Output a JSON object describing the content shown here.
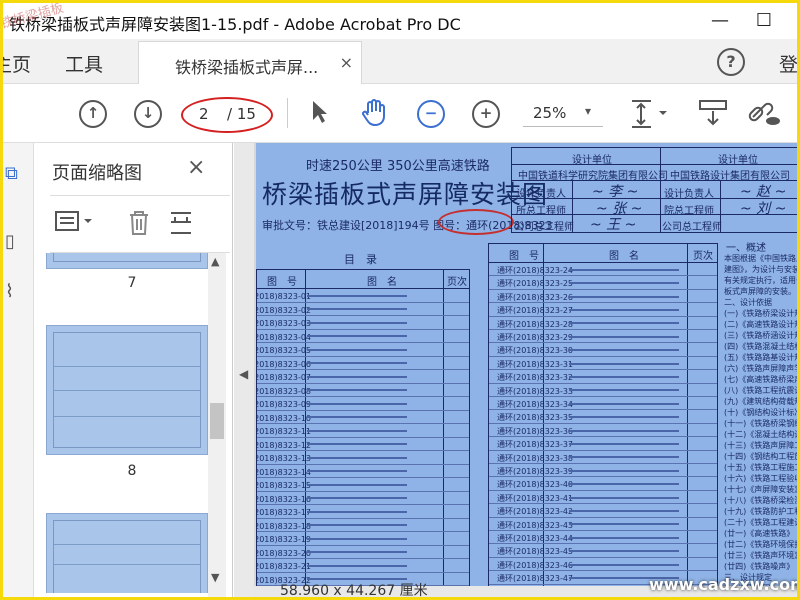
{
  "window": {
    "title": "铁桥梁插板式声屏障安装图1-15.pdf - Adobe Acrobat Pro DC",
    "minimize": "—",
    "maximize": "☐"
  },
  "menu": {
    "home": "主页",
    "tools": "工具",
    "tab_label": "铁桥梁插板式声屏...",
    "tab_close": "×",
    "help": "?",
    "login": "登"
  },
  "toolbar": {
    "page_current": "2",
    "page_total": "/ 15",
    "zoom": "25%",
    "zoom_arrow": "▾"
  },
  "panel": {
    "title": "页面缩略图",
    "close": "×",
    "thumb_labels": [
      "7",
      "8"
    ]
  },
  "document": {
    "header_small": "时速250公里   350公里高速铁路",
    "title": "桥梁插板式声屏障安装图",
    "approval": "审批文号：铁总建设[2018]194号 图号：通环(2018)8323",
    "sig": {
      "design_unit": "设计单位",
      "unit1": "中国铁道科学研究院集团有限公司",
      "unit2": "中国铁路设计集团有限公司",
      "design_lead1": "设计负责人",
      "chief1": "所总工程师",
      "company_chief1": "公司总工程师",
      "design_lead2": "设计负责人",
      "chief2": "院总工程师",
      "company_chief2": "公司总工程师"
    },
    "mulu": "目　录",
    "table_head": {
      "code": "图　号",
      "name": "图　名",
      "page": "页次"
    },
    "left_codes": [
      "通环(2018)8323-01",
      "通环(2018)8323-02",
      "通环(2018)8323-03",
      "通环(2018)8323-04",
      "通环(2018)8323-05",
      "通环(2018)8323-06",
      "通环(2018)8323-07",
      "通环(2018)8323-08",
      "通环(2018)8323-09",
      "通环(2018)8323-10",
      "通环(2018)8323-11",
      "通环(2018)8323-12",
      "通环(2018)8323-13",
      "通环(2018)8323-14",
      "通环(2018)8323-15",
      "通环(2018)8323-16",
      "通环(2018)8323-17",
      "通环(2018)8323-18",
      "通环(2018)8323-19",
      "通环(2018)8323-20",
      "通环(2018)8323-21",
      "通环(2018)8323-22",
      "通环(2018)8323-23"
    ],
    "right_codes": [
      "通环(2018)8323-24",
      "通环(2018)8323-25",
      "通环(2018)8323-26",
      "通环(2018)8323-27",
      "通环(2018)8323-28",
      "通环(2018)8323-29",
      "通环(2018)8323-30",
      "通环(2018)8323-31",
      "通环(2018)8323-32",
      "通环(2018)8323-33",
      "通环(2018)8323-34",
      "通环(2018)8323-35",
      "通环(2018)8323-36",
      "通环(2018)8323-37",
      "通环(2018)8323-38",
      "通环(2018)8323-39",
      "通环(2018)8323-40",
      "通环(2018)8323-41",
      "通环(2018)8323-42",
      "通环(2018)8323-43",
      "通环(2018)8323-44",
      "通环(2018)8323-45",
      "通环(2018)8323-46",
      "通环(2018)8323-47",
      "通环(2018)8323-48"
    ],
    "notes_title": "一、概述",
    "notes": [
      "本图根据《中国铁路总公司关于",
      "建图》，为设计与安装使用。",
      "有关规定执行，适用于时速",
      "板式声屏障的安装。",
      "二、设计依据",
      "(一)《铁路桥梁设计规范》",
      "(二)《高速铁路设计规范》",
      "(三)《铁路桥涵设计规范》",
      "(四)《铁路混凝土结构耐久》",
      "(五)《铁路路基设计规范》",
      "(六)《铁路声屏障声学构件》",
      "(七)《高速铁路桥梁声屏障》",
      "(八)《铁路工程抗震设计规范》",
      "(九)《建筑结构荷载规范》",
      "(十)《钢结构设计标准》",
      "(十一)《铁路桥梁钢结构》",
      "(十二)《混凝土结构设计》",
      "(十三)《铁路声屏障工程》",
      "(十四)《钢结构工程施工》",
      "(十五)《铁路工程施工》",
      "(十六)《铁路工程验收》",
      "(十七)《声屏障安装》",
      "(十八)《铁路桥梁检测》",
      "(十九)《铁路防护工程》",
      "(二十)《铁路工程建设》",
      "(廿一)《高速铁路》",
      "(廿二)《铁路环境保护》",
      "(廿三)《铁路声环境》",
      "(廿四)《铁路噪声》",
      "三、设计规定",
      "(一)适用范围",
      "(二)设计荷载"
    ]
  },
  "status": {
    "dims": "58.960 x 44.267 厘米"
  },
  "watermark": "www.cadzxw.com",
  "watermark_tl": "铁桥梁插板"
}
